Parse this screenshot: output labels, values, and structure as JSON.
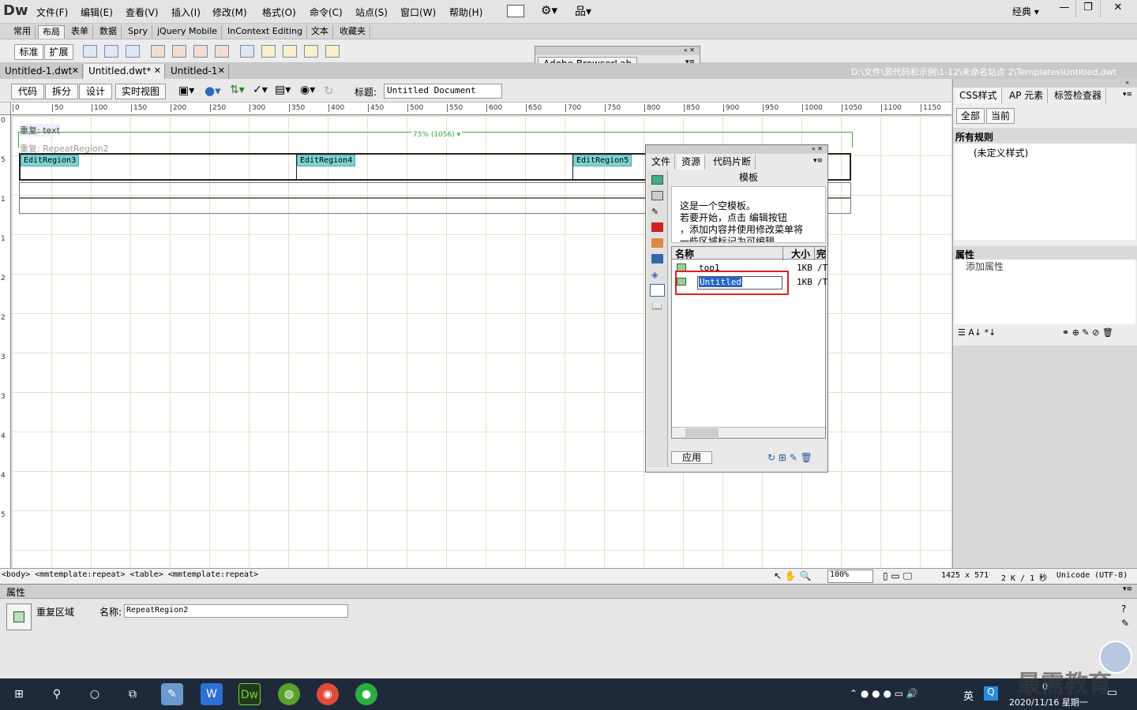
{
  "app": {
    "logo": "Dw",
    "menus": [
      "文件(F)",
      "编辑(E)",
      "查看(V)",
      "插入(I)",
      "修改(M)",
      "格式(O)",
      "命令(C)",
      "站点(S)",
      "窗口(W)",
      "帮助(H)"
    ],
    "workspace": "经典",
    "min": "—",
    "restore": "❐",
    "close": "✕"
  },
  "insert": {
    "tabs": [
      "常用",
      "布局",
      "表单",
      "数据",
      "Spry",
      "jQuery Mobile",
      "InContext Editing",
      "文本",
      "收藏夹"
    ],
    "active": "布局",
    "mode_buttons": [
      "标准",
      "扩展"
    ]
  },
  "browserlab": {
    "title": "Adobe BrowserLab"
  },
  "doc_tabs": [
    {
      "label": "Untitled-1.dwt",
      "close": "✕"
    },
    {
      "label": "Untitled.dwt*",
      "close": "✕"
    },
    {
      "label": "Untitled-1",
      "close": "✕"
    }
  ],
  "doc_path": "D:\\文件\\源代码和示例\\1-12\\未命名站点 2\\Templates\\Untitled.dwt",
  "doc_toolbar": {
    "views": [
      "代码",
      "拆分",
      "设计",
      "实时视图"
    ],
    "title_label": "标题:",
    "title_value": "Untitled Document"
  },
  "ruler": {
    "h": [
      "0",
      "50",
      "100",
      "150",
      "200",
      "250",
      "300",
      "350",
      "400",
      "450",
      "500",
      "550",
      "600",
      "650",
      "700",
      "750",
      "800",
      "850",
      "900",
      "950",
      "1000",
      "1050",
      "1100",
      "1150"
    ]
  },
  "design": {
    "repeat1": "重复: text",
    "repeat2": "重复: RepeatRegion2",
    "width_label": "75% (1056) ▾",
    "regions": [
      "EditRegion3",
      "EditRegion4",
      "EditRegion5"
    ]
  },
  "css_panel": {
    "tabs": [
      "CSS样式",
      "AP 元素",
      "标签检查器"
    ],
    "mode_buttons": [
      "全部",
      "当前"
    ],
    "all_rules": "所有规则",
    "undefined": "(未定义样式)",
    "properties": "属性",
    "add_property": "添加属性"
  },
  "assets_panel": {
    "tabs": [
      "文件",
      "资源",
      "代码片断"
    ],
    "heading": "模板",
    "preview_text": [
      "这是一个空模板。",
      "若要开始，点击 编辑按钮",
      "，添加内容并使用修改菜单将",
      "一些区域标记为可编辑。"
    ],
    "col_name": "名称",
    "col_size": "大小",
    "col_full": "完",
    "rows": [
      {
        "name": "top1",
        "size": "1KB",
        "path": "/T"
      },
      {
        "name": "Untitled",
        "size": "1KB",
        "path": "/T"
      }
    ],
    "apply": "应用"
  },
  "tag_bar": {
    "tags": "<body> <mmtemplate:repeat> <table> <mmtemplate:repeat>",
    "zoom": "100%",
    "size": "1425 x 571",
    "download": "2 K / 1 秒",
    "encoding": "Unicode (UTF-8)"
  },
  "properties": {
    "title": "属性",
    "type": "重复区域",
    "name_label": "名称:",
    "name_value": "RepeatRegion2"
  },
  "taskbar": {
    "time": "0",
    "date": "2020/11/16 星期一",
    "ime": "英",
    "watermark": "最需教育"
  },
  "colors": {
    "region": "#7fd3d3",
    "selection": "#2a63c8",
    "highlight_box": "#e02020"
  }
}
